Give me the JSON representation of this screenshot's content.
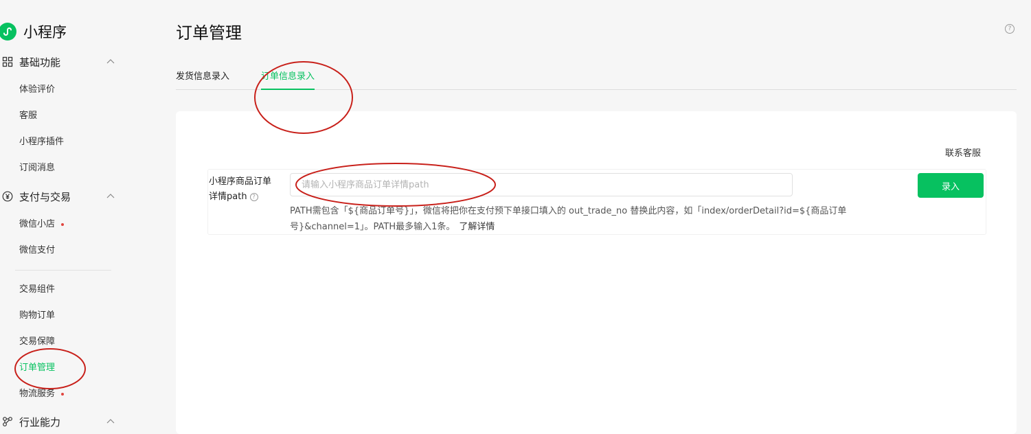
{
  "app": {
    "name": "小程序"
  },
  "sidebar": {
    "groups": [
      {
        "label": "基础功能",
        "icon": "grid-icon"
      },
      {
        "label": "支付与交易",
        "icon": "yen-icon"
      },
      {
        "label": "行业能力",
        "icon": "nodes-icon"
      }
    ],
    "basic_items": [
      {
        "label": "体验评价"
      },
      {
        "label": "客服"
      },
      {
        "label": "小程序插件"
      },
      {
        "label": "订阅消息"
      }
    ],
    "pay_items": [
      {
        "label": "微信小店",
        "badge_dot": true
      },
      {
        "label": "微信支付"
      }
    ],
    "trade_items": [
      {
        "label": "交易组件"
      },
      {
        "label": "购物订单"
      },
      {
        "label": "交易保障"
      },
      {
        "label": "订单管理",
        "active": true
      },
      {
        "label": "物流服务",
        "badge_dot": true
      }
    ]
  },
  "main": {
    "title": "订单管理",
    "tabs": [
      {
        "label": "发货信息录入",
        "active": false
      },
      {
        "label": "订单信息录入",
        "active": true
      }
    ],
    "contact_link": "联系客服",
    "form": {
      "label_line1": "小程序商品订单",
      "label_line2": "详情path",
      "placeholder": "请输入小程序商品订单详情path",
      "value": "",
      "submit_label": "录入",
      "hint": "PATH需包含「${商品订单号}」，微信将把你在支付预下单接口填入的 out_trade_no 替换此内容，如「index/orderDetail?id=${商品订单号}&channel=1」。PATH最多输入1条。",
      "hint_link": "了解详情"
    }
  },
  "colors": {
    "accent": "#07c160",
    "badge": "#e0453f",
    "annotation": "#c8201a"
  }
}
